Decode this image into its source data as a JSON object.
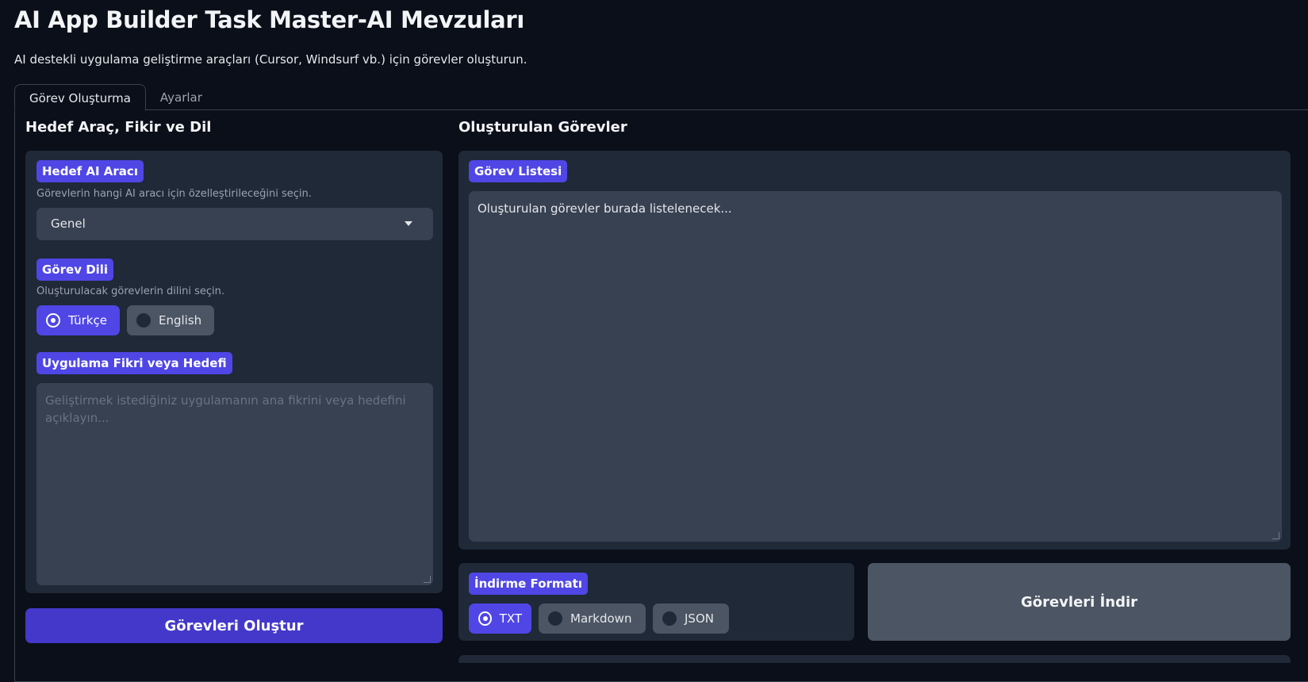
{
  "header": {
    "title": "AI App Builder Task Master-AI Mevzuları",
    "subtitle": "AI destekli uygulama geliştirme araçları (Cursor, Windsurf vb.) için görevler oluşturun."
  },
  "tabs": [
    {
      "label": "Görev Oluşturma",
      "active": true
    },
    {
      "label": "Ayarlar",
      "active": false
    }
  ],
  "left": {
    "heading": "Hedef Araç, Fikir ve Dil",
    "tool": {
      "label": "Hedef AI Aracı",
      "hint": "Görevlerin hangi AI aracı için özelleştirileceğini seçin.",
      "selected": "Genel"
    },
    "language": {
      "label": "Görev Dili",
      "hint": "Oluşturulacak görevlerin dilini seçin.",
      "options": [
        "Türkçe",
        "English"
      ],
      "selected": "Türkçe"
    },
    "idea": {
      "label": "Uygulama Fikri veya Hedefi",
      "placeholder": "Geliştirmek istediğiniz uygulamanın ana fikrini veya hedefini açıklayın..."
    },
    "generate_button": "Görevleri Oluştur"
  },
  "right": {
    "heading": "Oluşturulan Görevler",
    "list": {
      "label": "Görev Listesi",
      "placeholder": "Oluşturulan görevler burada listelenecek..."
    },
    "download_format": {
      "label": "İndirme Formatı",
      "options": [
        "TXT",
        "Markdown",
        "JSON"
      ],
      "selected": "TXT"
    },
    "download_button": "Görevleri İndir"
  },
  "colors": {
    "background": "#0b0f19",
    "panel": "#1f2937",
    "accent": "#4f46e5",
    "input": "#374151"
  }
}
